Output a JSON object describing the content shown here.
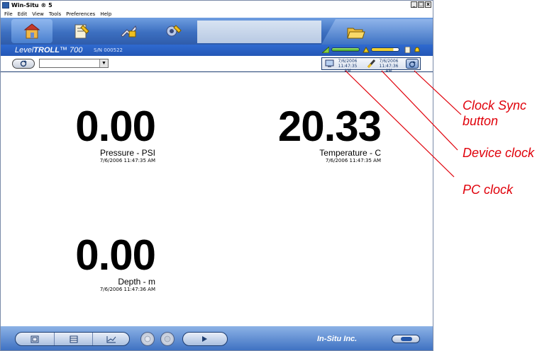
{
  "window": {
    "title": "Win-Situ ® 5",
    "minimize": "_",
    "maximize": "□",
    "close": "x"
  },
  "menu": [
    "File",
    "Edit",
    "View",
    "Tools",
    "Preferences",
    "Help"
  ],
  "device": {
    "model_prefix": "Level",
    "model_bold": "TROLL",
    "model_suffix": "™ 700",
    "serial": "S/N 000522"
  },
  "status": {
    "battery_level": 1.0,
    "memory_level": 0.8
  },
  "clocks": {
    "pc_date": "7/6/2006",
    "pc_time": "11:47:35 AM",
    "device_date": "7/6/2006",
    "device_time": "11:47:36 AM"
  },
  "readings": [
    {
      "value": "0.00",
      "label": "Pressure - PSI",
      "time": "7/6/2006 11:47:35 AM"
    },
    {
      "value": "20.33",
      "label": "Temperature - C",
      "time": "7/6/2006 11:47:35 AM"
    },
    {
      "value": "0.00",
      "label": "Depth - m",
      "time": "7/6/2006 11:47:36 AM"
    }
  ],
  "brand": "In-Situ Inc.",
  "annotations": {
    "clock_sync_line1": "Clock Sync",
    "clock_sync_line2": "button",
    "device_clock": "Device clock",
    "pc_clock": "PC clock"
  },
  "colors": {
    "accent": "#2f6ad0",
    "annotation": "#e0000a"
  }
}
